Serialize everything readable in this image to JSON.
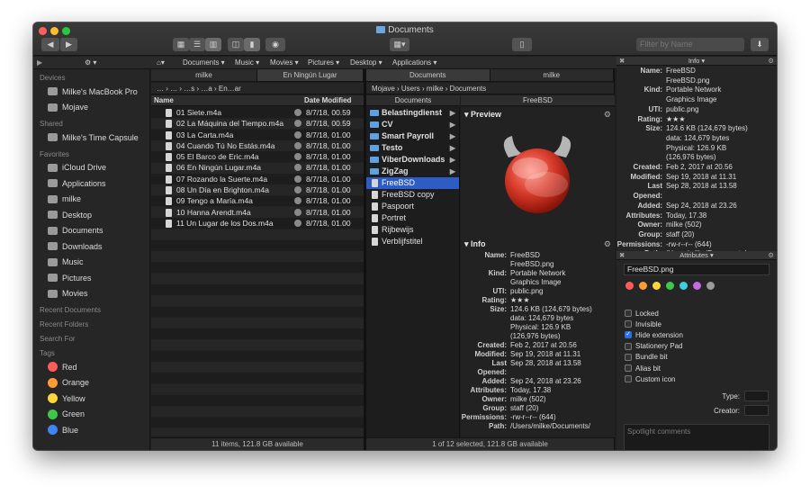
{
  "window": {
    "title": "Documents",
    "search_placeholder": "Filter by Name"
  },
  "colors": {
    "close": "#ff5f57",
    "minimize": "#febc2e",
    "zoom": "#28c840",
    "selection": "#2d5cc4",
    "folder": "#5ea0e0"
  },
  "crumbs": [
    "Documents ▾",
    "Music ▾",
    "Movies ▾",
    "Pictures ▾",
    "Desktop ▾",
    "Applications ▾"
  ],
  "sidebar": {
    "devices_header": "Devices",
    "devices": [
      "Milke's MacBook Pro",
      "Mojave"
    ],
    "shared_header": "Shared",
    "shared": [
      "Milke's Time Capsule"
    ],
    "favorites_header": "Favorites",
    "favorites": [
      "iCloud Drive",
      "Applications",
      "milke",
      "Desktop",
      "Documents",
      "Downloads",
      "Music",
      "Pictures",
      "Movies"
    ],
    "recent_documents": "Recent Documents",
    "recent_folders": "Recent Folders",
    "search_for": "Search For",
    "tags_header": "Tags",
    "tags": [
      {
        "name": "Red",
        "color": "#ff5b5b"
      },
      {
        "name": "Orange",
        "color": "#ff9a35"
      },
      {
        "name": "Yellow",
        "color": "#ffd43b"
      },
      {
        "name": "Green",
        "color": "#3ec84a"
      },
      {
        "name": "Blue",
        "color": "#3e86f5"
      }
    ]
  },
  "left_pane": {
    "tabs": [
      "milke",
      "En Ningún Lugar"
    ],
    "path": "… › … › …s › …a › En…ar",
    "col_name": "Name",
    "col_date": "Date Modified",
    "files": [
      {
        "name": "01 Siete.m4a",
        "date": "8/7/18, 00.59"
      },
      {
        "name": "02 La Máquina del Tiempo.m4a",
        "date": "8/7/18, 00.59"
      },
      {
        "name": "03 La Carta.m4a",
        "date": "8/7/18, 01.00"
      },
      {
        "name": "04 Cuando Tú No Estás.m4a",
        "date": "8/7/18, 01.00"
      },
      {
        "name": "05 El Barco de Eric.m4a",
        "date": "8/7/18, 01.00"
      },
      {
        "name": "06 En Ningún Lugar.m4a",
        "date": "8/7/18, 01.00"
      },
      {
        "name": "07 Rozando la Suerte.m4a",
        "date": "8/7/18, 01.00"
      },
      {
        "name": "08 Un Día en Brighton.m4a",
        "date": "8/7/18, 01.00"
      },
      {
        "name": "09 Tengo a María.m4a",
        "date": "8/7/18, 01.00"
      },
      {
        "name": "10 Hanna Arendt.m4a",
        "date": "8/7/18, 01.00"
      },
      {
        "name": "11 Un Lugar de los Dos.m4a",
        "date": "8/7/18, 01.00"
      }
    ],
    "status": "11 items, 121.8 GB available"
  },
  "right_pane": {
    "tabs": [
      "Documents",
      "milke"
    ],
    "path": "Mojave › Users › milke › Documents",
    "col1_header": "Documents",
    "col2_header": "FreeBSD",
    "items": [
      {
        "name": "Belastingdienst",
        "type": "folder",
        "bold": true,
        "chevron": "▶"
      },
      {
        "name": "CV",
        "type": "folder",
        "bold": true,
        "chevron": "▶"
      },
      {
        "name": "Smart Payroll",
        "type": "folder",
        "bold": true,
        "chevron": "▶"
      },
      {
        "name": "Testo",
        "type": "folder",
        "bold": true,
        "chevron": "▶"
      },
      {
        "name": "ViberDownloads",
        "type": "folder",
        "bold": true,
        "chevron": "▶"
      },
      {
        "name": "ZigZag",
        "type": "folder",
        "bold": true,
        "chevron": "▶"
      },
      {
        "name": "FreeBSD",
        "type": "doc",
        "bold": false,
        "selected": true,
        "chevron": ""
      },
      {
        "name": "FreeBSD copy",
        "type": "doc",
        "bold": false,
        "chevron": ""
      },
      {
        "name": "Paspoort",
        "type": "doc",
        "bold": false,
        "chevron": ""
      },
      {
        "name": "Portret",
        "type": "doc",
        "bold": false,
        "chevron": ""
      },
      {
        "name": "Rijbewijs",
        "type": "doc",
        "bold": false,
        "chevron": ""
      },
      {
        "name": "Verblijfstitel",
        "type": "doc",
        "bold": false,
        "chevron": ""
      }
    ],
    "preview_label": "Preview",
    "info_label": "Info",
    "status": "1 of 12 selected, 121.8 GB available"
  },
  "info": [
    {
      "k": "Name:",
      "v": "FreeBSD\nFreeBSD.png"
    },
    {
      "k": "Kind:",
      "v": "Portable Network\nGraphics Image"
    },
    {
      "k": "UTI:",
      "v": "public.png"
    },
    {
      "k": "Rating:",
      "v": "★★★"
    },
    {
      "k": "Size:",
      "v": "124.6 KB (124,679 bytes)\ndata: 124,679 bytes\nPhysical: 126.9 KB\n(126,976 bytes)"
    },
    {
      "k": "",
      "v": " "
    },
    {
      "k": "Created:",
      "v": "Feb 2, 2017 at 20.56"
    },
    {
      "k": "Modified:",
      "v": "Sep 19, 2018 at 11.31"
    },
    {
      "k": "Last Opened:",
      "v": "Sep 28, 2018 at 13.58"
    },
    {
      "k": "Added:",
      "v": "Sep 24, 2018 at 23.26"
    },
    {
      "k": "Attributes:",
      "v": "Today, 17.38"
    },
    {
      "k": "Owner:",
      "v": "milke (502)"
    },
    {
      "k": "Group:",
      "v": "staff (20)"
    },
    {
      "k": "Permissions:",
      "v": "-rw-r--r-- (644)"
    },
    {
      "k": "Path:",
      "v": "/Users/milke/Documents/"
    }
  ],
  "inspector": {
    "info_title": "Info ▾",
    "attrs_title": "Attributes ▾",
    "filename": "FreeBSD.png",
    "tag_colors": [
      "#ff5b5b",
      "#ff9a35",
      "#ffd43b",
      "#3ec84a",
      "#3ecfe0",
      "#c56ae0",
      "#9a9a9a"
    ],
    "checks": [
      {
        "label": "Locked",
        "on": false
      },
      {
        "label": "Invisible",
        "on": false
      },
      {
        "label": "Hide extension",
        "on": true
      },
      {
        "label": "Stationery Pad",
        "on": false
      },
      {
        "label": "Bundle bit",
        "on": false
      },
      {
        "label": "Alias bit",
        "on": false
      },
      {
        "label": "Custom icon",
        "on": false
      }
    ],
    "type_label": "Type:",
    "creator_label": "Creator:",
    "comments_placeholder": "Spotlight comments"
  }
}
